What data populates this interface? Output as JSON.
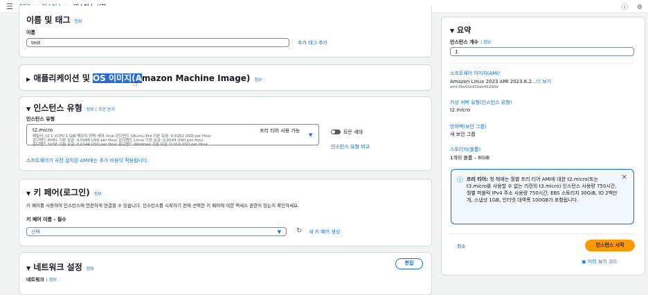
{
  "header": {
    "menu_glyph": "☰",
    "crumbs": [
      "EC2",
      "인스턴스",
      "인스턴스 시작"
    ],
    "sep": ">",
    "info_glyph": "ⓘ",
    "settings_glyph": "⚙"
  },
  "name_tag": {
    "title": "이름 및 태그",
    "info": "정보",
    "name_label": "이름",
    "name_value": "test",
    "add_tags": "추가 태그 추가"
  },
  "ami": {
    "prefix": "애플리케이션 및 ",
    "highlight": "OS 이미지(A",
    "suffix": "mazon Machine Image)",
    "info": "정보"
  },
  "instance_type": {
    "title": "인스턴스 유형",
    "info": "정보",
    "compare_link": "조언 받기",
    "label": "인스턴스 유형",
    "selected": "t2.micro",
    "free_tier": "프리 티어 사용 가능",
    "line1": "패밀리: t2    1 vCPU    1 GiB 메모리    현재 세대: true      온디맨드 Ubuntu Pro 기본 요금: 0.0162 USD per Hour",
    "line2": "온디맨드 RHEL 기본 요금: 0.0288 USD per Hour     온디맨드 Linux 기본 요금: 0.0144 USD per Hour",
    "line3": "온디맨드 SUSE 기본 요금: 0.0144 USD per Hour     온디맨드 Windows 기본 요금: 0.019 USD per Hour",
    "all_gen": "모든 세대",
    "compare_types": "인스턴스 유형 비교",
    "ami_cost": "소프트웨어가 사전 설치된 AMI에는 추가 비용이 적용됩니다."
  },
  "key_pair": {
    "title": "키 페어(로그인)",
    "info": "정보",
    "desc": "키 페어를 사용하여 인스턴스에 안전하게 연결할 수 있습니다. 인스턴스를 시작하기 전에 선택한 키 페어에 대한 액세스 권한이 있는지 확인하세요.",
    "label": "키 페어 이름 - 필수",
    "placeholder": "선택",
    "create": "새 키 페어 생성"
  },
  "network": {
    "title": "네트워크 설정",
    "info": "정보",
    "edit": "편집",
    "network_label": "네트워크",
    "network_info": "정보"
  },
  "summary": {
    "title": "요약",
    "count_label": "인스턴스 개수",
    "count_info": "정보",
    "count_value": "1",
    "sw_title": "소프트웨어 이미지(AMI)",
    "sw_value": "Amazon Linux 2023 AMI 2023.6.2...",
    "sw_more": "더 보기",
    "sw_id": "ami-0fa42ed59ab46290d",
    "vs_title": "가상 서버 유형(인스턴스 유형)",
    "vs_value": "t2.micro",
    "fw_title": "방화벽(보안 그룹)",
    "fw_value": "새 보안 그룹",
    "storage_title": "스토리지(볼륨)",
    "storage_value": "1개의 볼륨 – 8GiB",
    "alert": "프리 티어: 첫 해에는 월별 프리 티어 AMI에 대한 t2.micro(또는 t3.micro를 사용할 수 없는 리전의 t3.micro) 인스턴스 사용량 750시간, 월별 퍼블릭 IPv4 주소 사용량 750시간, EBS 스토리지 30GiB, IO 2백만 개, 스냅샷 1GB, 인터넷 대역폭 100GB가 포함됩니다.",
    "alert_bold": "프리 티어:",
    "cancel": "취소",
    "launch": "인스턴스 시작",
    "preview": "미리 보기 코드"
  },
  "colors": {
    "accent": "#0972d3",
    "primary_button": "#ff9900",
    "highlight": "#2a6bd4"
  }
}
